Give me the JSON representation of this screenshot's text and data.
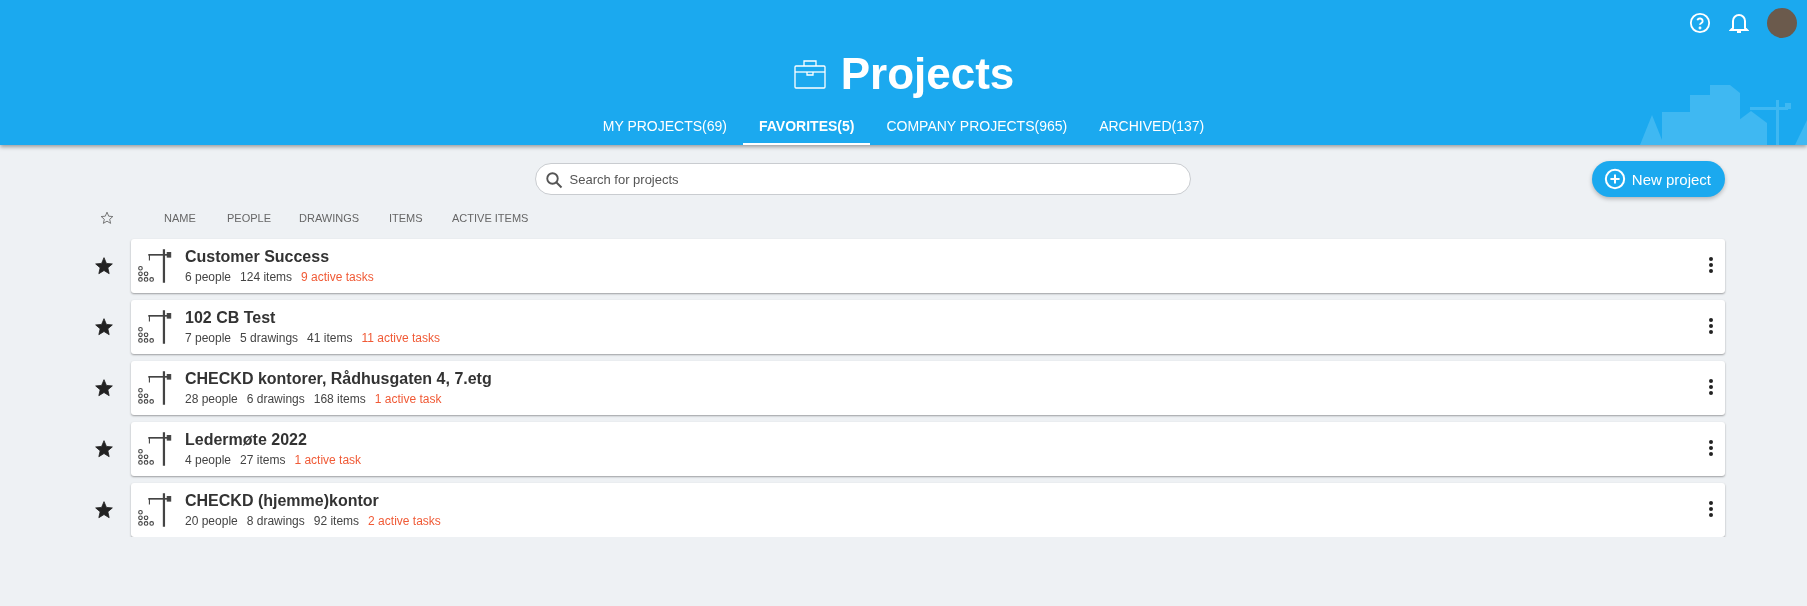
{
  "header": {
    "title": "Projects",
    "tabs": [
      {
        "label": "MY PROJECTS(69)",
        "selected": false
      },
      {
        "label": "FAVORITES(5)",
        "selected": true
      },
      {
        "label": "COMPANY PROJECTS(965)",
        "selected": false
      },
      {
        "label": "ARCHIVED(137)",
        "selected": false
      }
    ]
  },
  "search": {
    "placeholder": "Search for projects"
  },
  "new_project_button": "New project",
  "columns": {
    "favorite_filter": false,
    "labels": [
      "NAME",
      "PEOPLE",
      "DRAWINGS",
      "ITEMS",
      "ACTIVE ITEMS"
    ]
  },
  "projects": [
    {
      "name": "Customer Success",
      "favorite": true,
      "stats": [
        {
          "text": "6 people",
          "kind": "count"
        },
        {
          "text": "124 items",
          "kind": "count"
        },
        {
          "text": "9 active tasks",
          "kind": "active"
        }
      ]
    },
    {
      "name": "102 CB Test",
      "favorite": true,
      "stats": [
        {
          "text": "7 people",
          "kind": "count"
        },
        {
          "text": "5 drawings",
          "kind": "count"
        },
        {
          "text": "41 items",
          "kind": "count"
        },
        {
          "text": "11 active tasks",
          "kind": "active"
        }
      ]
    },
    {
      "name": "CHECKD kontorer, Rådhusgaten 4, 7.etg",
      "favorite": true,
      "stats": [
        {
          "text": "28 people",
          "kind": "count"
        },
        {
          "text": "6 drawings",
          "kind": "count"
        },
        {
          "text": "168 items",
          "kind": "count"
        },
        {
          "text": "1 active task",
          "kind": "active"
        }
      ]
    },
    {
      "name": "Ledermøte 2022",
      "favorite": true,
      "stats": [
        {
          "text": "4 people",
          "kind": "count"
        },
        {
          "text": "27 items",
          "kind": "count"
        },
        {
          "text": "1 active task",
          "kind": "active"
        }
      ]
    },
    {
      "name": "CHECKD (hjemme)kontor",
      "favorite": true,
      "stats": [
        {
          "text": "20 people",
          "kind": "count"
        },
        {
          "text": "8 drawings",
          "kind": "count"
        },
        {
          "text": "92 items",
          "kind": "count"
        },
        {
          "text": "2 active tasks",
          "kind": "active"
        }
      ]
    }
  ]
}
